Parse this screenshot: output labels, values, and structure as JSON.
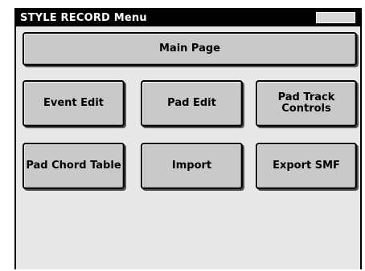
{
  "window": {
    "title": "STYLE RECORD Menu"
  },
  "buttons": {
    "main_page": "Main Page",
    "event_edit": "Event Edit",
    "pad_edit": "Pad Edit",
    "pad_track_controls": "Pad Track\nControls",
    "pad_chord_table": "Pad Chord Table",
    "import": "Import",
    "export_smf": "Export SMF"
  },
  "colors": {
    "title_bar": "#000000",
    "title_text": "#ffffff",
    "screen_bg": "#e8e8e8",
    "button_face": "#c9c9c9"
  }
}
